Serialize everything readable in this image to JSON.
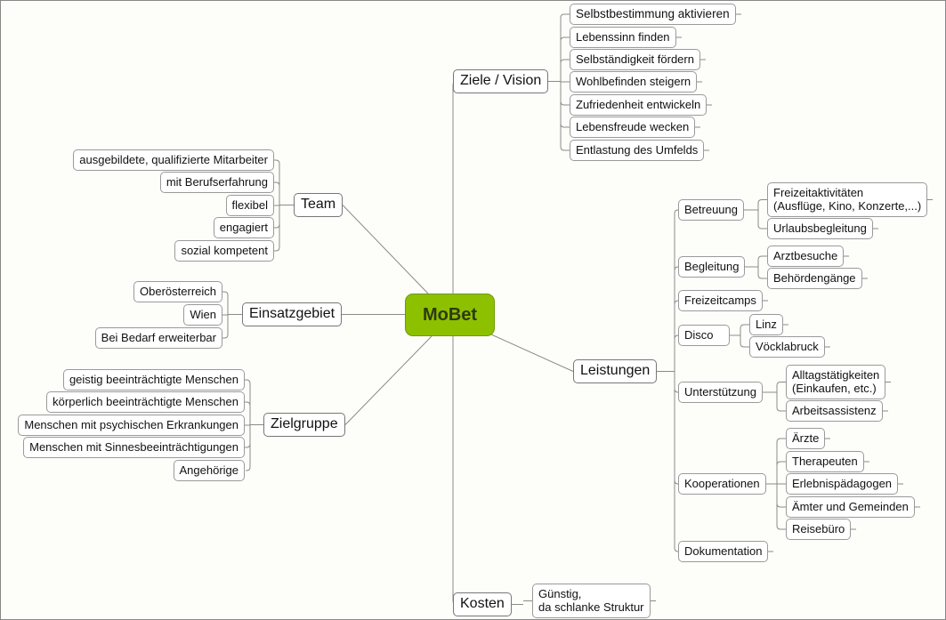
{
  "center": "MoBet",
  "colors": {
    "center": "#8dc100",
    "line": "#8a8a8a",
    "node_border": "#9a9a9a"
  },
  "ziele": {
    "label": "Ziele / Vision",
    "items": [
      "Selbstbestimmung aktivieren",
      "Lebenssinn finden",
      "Selbständigkeit fördern",
      "Wohlbefinden steigern",
      "Zufriedenheit entwickeln",
      "Lebensfreude wecken",
      "Entlastung des Umfelds"
    ]
  },
  "leistungen": {
    "label": "Leistungen",
    "betreuung": {
      "label": "Betreuung",
      "items": [
        "Freizeitaktivitäten\n(Ausflüge, Kino, Konzerte,...)",
        "Urlaubsbegleitung"
      ]
    },
    "begleitung": {
      "label": "Begleitung",
      "items": [
        "Arztbesuche",
        "Behördengänge"
      ]
    },
    "freizeitcamps": {
      "label": "Freizeitcamps"
    },
    "disco": {
      "label": "Disco",
      "items": [
        "Linz",
        "Vöcklabruck"
      ]
    },
    "unterstuetzung": {
      "label": "Unterstützung",
      "items": [
        "Alltagstätigkeiten\n(Einkaufen, etc.)",
        "Arbeitsassistenz"
      ]
    },
    "kooperationen": {
      "label": "Kooperationen",
      "items": [
        "Ärzte",
        "Therapeuten",
        "Erlebnispädagogen",
        "Ämter und Gemeinden",
        "Reisebüro"
      ]
    },
    "dokumentation": {
      "label": "Dokumentation"
    }
  },
  "kosten": {
    "label": "Kosten",
    "items": [
      "Günstig,\nda schlanke Struktur"
    ]
  },
  "team": {
    "label": "Team",
    "items": [
      "ausgebildete, qualifizierte Mitarbeiter",
      "mit Berufserfahrung",
      "flexibel",
      "engagiert",
      "sozial kompetent"
    ]
  },
  "einsatzgebiet": {
    "label": "Einsatzgebiet",
    "items": [
      "Oberösterreich",
      "Wien",
      "Bei Bedarf erweiterbar"
    ]
  },
  "zielgruppe": {
    "label": "Zielgruppe",
    "items": [
      "geistig beeinträchtigte Menschen",
      "körperlich beeinträchtigte Menschen",
      "Menschen mit psychischen Erkrankungen",
      "Menschen mit Sinnesbeeinträchtigungen",
      "Angehörige"
    ]
  }
}
